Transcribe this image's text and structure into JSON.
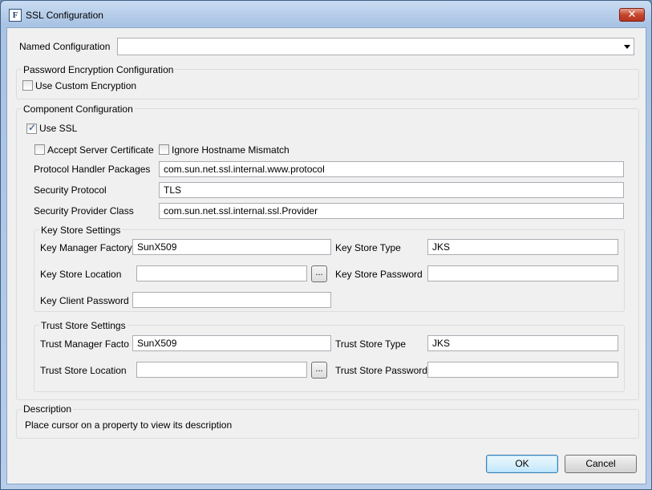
{
  "window": {
    "title": "SSL Configuration",
    "app_icon": "F",
    "close_glyph": "✕"
  },
  "named_configuration": {
    "label": "Named Configuration",
    "value": ""
  },
  "password_encryption": {
    "title": "Password Encryption Configuration",
    "use_custom_encryption": {
      "label": "Use Custom Encryption",
      "checked": false
    }
  },
  "component": {
    "title": "Component Configuration",
    "use_ssl": {
      "label": "Use SSL",
      "checked": true
    },
    "accept_server_certificate": {
      "label": "Accept Server Certificate",
      "checked": false
    },
    "ignore_hostname_mismatch": {
      "label": "Ignore Hostname Mismatch",
      "checked": false
    },
    "protocol_handler_packages": {
      "label": "Protocol Handler Packages",
      "value": "com.sun.net.ssl.internal.www.protocol"
    },
    "security_protocol": {
      "label": "Security Protocol",
      "value": "TLS"
    },
    "security_provider_class": {
      "label": "Security Provider Class",
      "value": "com.sun.net.ssl.internal.ssl.Provider"
    }
  },
  "key_store": {
    "title": "Key Store Settings",
    "key_manager_factory": {
      "label": "Key Manager Factory",
      "value": "SunX509"
    },
    "key_store_type": {
      "label": "Key Store Type",
      "value": "JKS"
    },
    "key_store_location": {
      "label": "Key Store Location",
      "value": ""
    },
    "key_store_password": {
      "label": "Key Store Password",
      "value": ""
    },
    "key_client_password": {
      "label": "Key Client Password",
      "value": ""
    },
    "browse_label": "..."
  },
  "trust_store": {
    "title": "Trust Store Settings",
    "trust_manager_factory": {
      "label": "Trust Manager Facto",
      "value": "SunX509"
    },
    "trust_store_type": {
      "label": "Trust Store Type",
      "value": "JKS"
    },
    "trust_store_location": {
      "label": "Trust Store Location",
      "value": ""
    },
    "trust_store_password": {
      "label": "Trust Store Password",
      "value": ""
    },
    "browse_label": "..."
  },
  "description": {
    "title": "Description",
    "text": "Place cursor on a property to view its description"
  },
  "buttons": {
    "ok": "OK",
    "cancel": "Cancel"
  }
}
